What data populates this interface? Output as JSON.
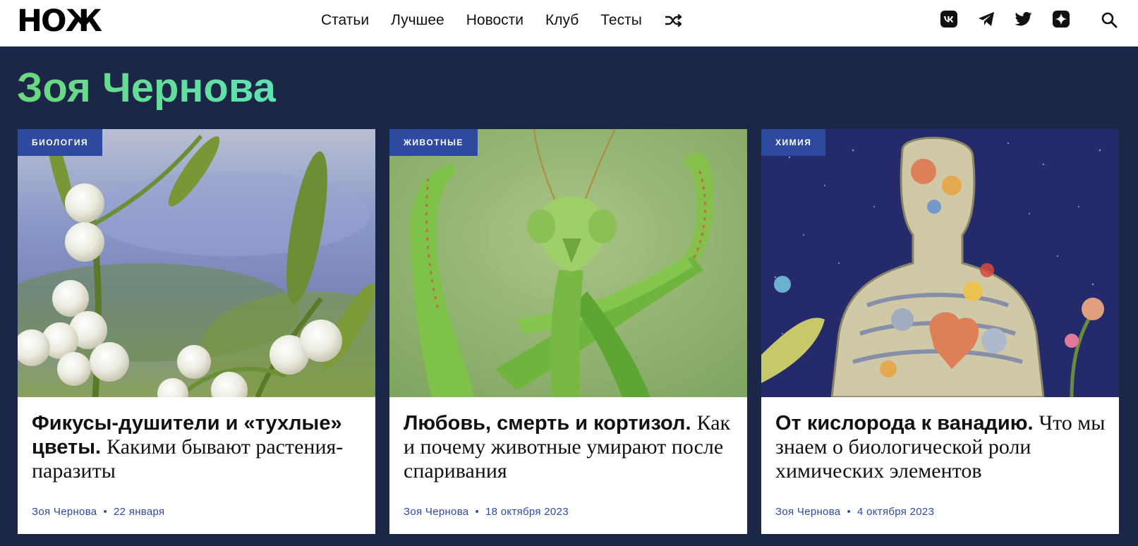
{
  "header": {
    "logo": "НОЖ",
    "nav": [
      {
        "label": "Статьи"
      },
      {
        "label": "Лучшее"
      },
      {
        "label": "Новости"
      },
      {
        "label": "Клуб"
      },
      {
        "label": "Тесты"
      }
    ],
    "shuffle_icon": "shuffle-icon",
    "socials": [
      "vk-icon",
      "telegram-icon",
      "twitter-icon",
      "dzen-icon"
    ],
    "search_icon": "search-icon"
  },
  "author": {
    "name": "Зоя Чернова"
  },
  "colors": {
    "background": "#1c2748",
    "accent_tag": "#2d4aa0",
    "title_gradient_start": "#6ad87c",
    "title_gradient_end": "#5ee3b2"
  },
  "cards": [
    {
      "tag": "БИОЛОГИЯ",
      "headline": "Фикусы-душители и «тухлые» цветы.",
      "subhead": "Какими бывают растения-паразиты",
      "author": "Зоя Чернова",
      "date": "22 января",
      "image": "mistletoe-berries-photo"
    },
    {
      "tag": "ЖИВОТНЫЕ",
      "headline": "Любовь, смерть и кортизол.",
      "subhead": "Как и почему животные умирают после спаривания",
      "author": "Зоя Чернова",
      "date": "18 октября 2023",
      "image": "praying-mantis-photo"
    },
    {
      "tag": "ХИМИЯ",
      "headline": "От кислорода к ванадию.",
      "subhead": "Что мы знаем о биологической роли химических элементов",
      "author": "Зоя Чернова",
      "date": "4 октября 2023",
      "image": "human-body-illustration"
    }
  ],
  "meta_separator": "•"
}
